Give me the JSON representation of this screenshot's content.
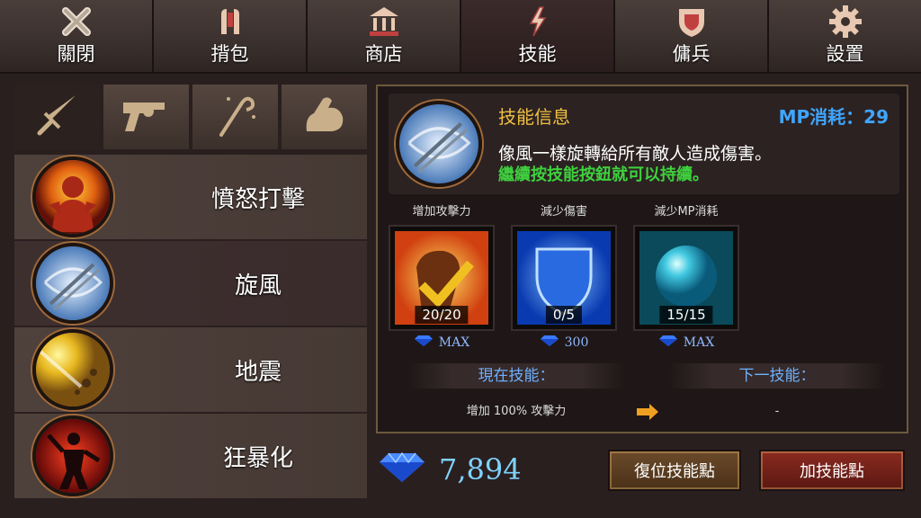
{
  "nav": {
    "tabs": [
      {
        "label": "關閉",
        "icon": "close-icon"
      },
      {
        "label": "揹包",
        "icon": "backpack-icon"
      },
      {
        "label": "商店",
        "icon": "shop-icon"
      },
      {
        "label": "技能",
        "icon": "skill-icon"
      },
      {
        "label": "傭兵",
        "icon": "shield-icon"
      },
      {
        "label": "設置",
        "icon": "gear-icon"
      }
    ],
    "active": "技能"
  },
  "categories": [
    {
      "icon": "sword-icon"
    },
    {
      "icon": "revolver-icon"
    },
    {
      "icon": "staff-icon"
    },
    {
      "icon": "muscle-arm-icon"
    }
  ],
  "skills": [
    {
      "name": "憤怒打擊",
      "icon": "rage-strike-icon"
    },
    {
      "name": "旋風",
      "icon": "whirlwind-icon"
    },
    {
      "name": "地震",
      "icon": "earthquake-icon"
    },
    {
      "name": "狂暴化",
      "icon": "berserk-icon"
    }
  ],
  "info": {
    "title": "技能信息",
    "mp_cost": "MP消耗：29",
    "description": "像風一樣旋轉給所有敵人造成傷害。",
    "hint": "繼續按技能按鈕就可以持續。"
  },
  "upgrades": [
    {
      "label": "增加攻擊力",
      "count": "20/20",
      "cost": "MAX",
      "icon": "attack-up-icon"
    },
    {
      "label": "減少傷害",
      "count": "0/5",
      "cost": "300",
      "icon": "defense-shield-icon"
    },
    {
      "label": "減少MP消耗",
      "count": "15/15",
      "cost": "MAX",
      "icon": "mana-orb-icon"
    }
  ],
  "compare": {
    "current_label": "現在技能：",
    "next_label": "下一技能：",
    "current_effect": "增加 100% 攻擊力",
    "next_effect": "-"
  },
  "currency": {
    "gems": "7,894"
  },
  "buttons": {
    "reset": "復位技能點",
    "add": "加技能點"
  },
  "colors": {
    "accent_gold": "#f0c040",
    "mp_blue": "#3ea6ff",
    "hint_green": "#3ed13e"
  }
}
